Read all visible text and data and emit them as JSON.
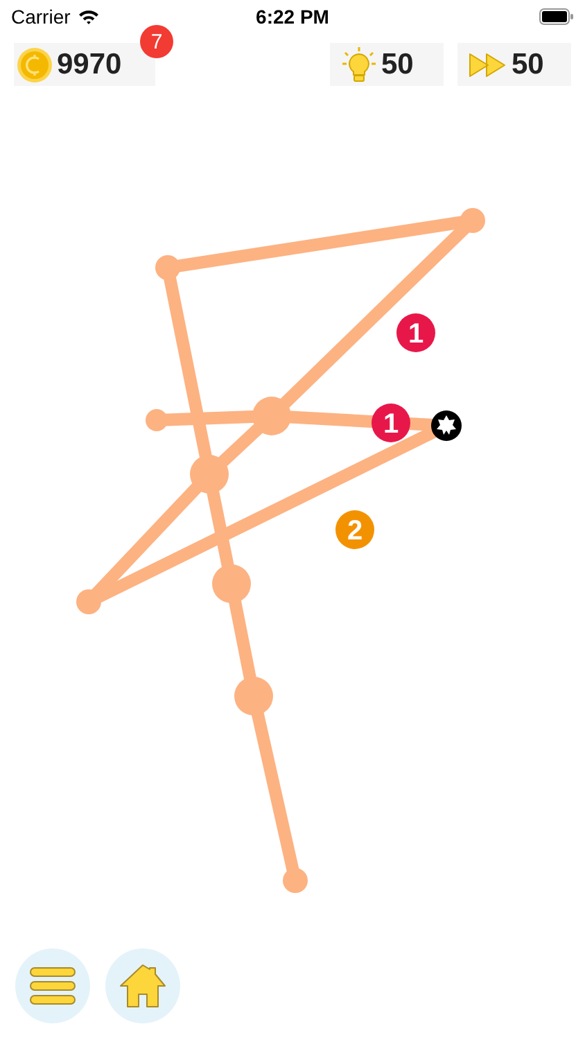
{
  "status_bar": {
    "carrier": "Carrier",
    "time": "6:22 PM"
  },
  "coins": {
    "amount": "9970",
    "badge": "7"
  },
  "hints": {
    "count": "50"
  },
  "skips": {
    "count": "50"
  },
  "markers": [
    {
      "label": "1",
      "color": "#e8174a"
    },
    {
      "label": "1",
      "color": "#e8174a"
    },
    {
      "label": "2",
      "color": "#f39200"
    }
  ]
}
